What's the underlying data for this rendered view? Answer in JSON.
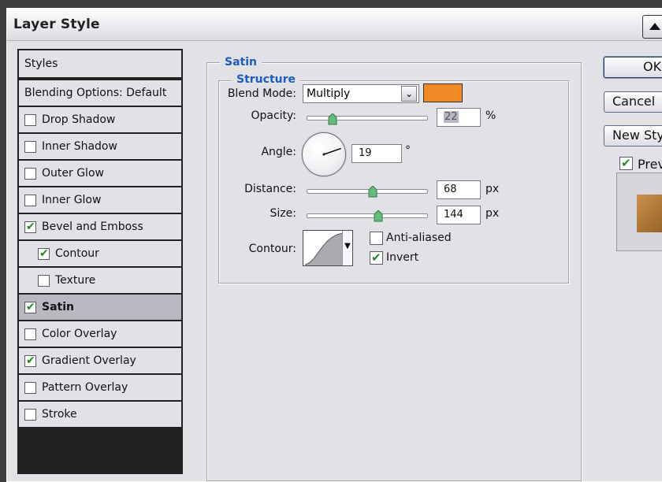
{
  "window": {
    "title": "Layer Style"
  },
  "styles_list": {
    "items": [
      {
        "label": "Styles",
        "has_checkbox": false,
        "checked": false,
        "selected": false,
        "indent": false
      },
      {
        "label": "Blending Options: Default",
        "has_checkbox": false,
        "checked": false,
        "selected": false,
        "indent": false
      },
      {
        "label": "Drop Shadow",
        "has_checkbox": true,
        "checked": false,
        "selected": false,
        "indent": false
      },
      {
        "label": "Inner Shadow",
        "has_checkbox": true,
        "checked": false,
        "selected": false,
        "indent": false
      },
      {
        "label": "Outer Glow",
        "has_checkbox": true,
        "checked": false,
        "selected": false,
        "indent": false
      },
      {
        "label": "Inner Glow",
        "has_checkbox": true,
        "checked": false,
        "selected": false,
        "indent": false
      },
      {
        "label": "Bevel and Emboss",
        "has_checkbox": true,
        "checked": true,
        "selected": false,
        "indent": false
      },
      {
        "label": "Contour",
        "has_checkbox": true,
        "checked": true,
        "selected": false,
        "indent": true
      },
      {
        "label": "Texture",
        "has_checkbox": true,
        "checked": false,
        "selected": false,
        "indent": true
      },
      {
        "label": "Satin",
        "has_checkbox": true,
        "checked": true,
        "selected": true,
        "indent": false
      },
      {
        "label": "Color Overlay",
        "has_checkbox": true,
        "checked": false,
        "selected": false,
        "indent": false
      },
      {
        "label": "Gradient Overlay",
        "has_checkbox": true,
        "checked": true,
        "selected": false,
        "indent": false
      },
      {
        "label": "Pattern Overlay",
        "has_checkbox": true,
        "checked": false,
        "selected": false,
        "indent": false
      },
      {
        "label": "Stroke",
        "has_checkbox": true,
        "checked": false,
        "selected": false,
        "indent": false
      }
    ]
  },
  "satin": {
    "title": "Satin",
    "structure": {
      "title": "Structure",
      "blend_mode": {
        "label": "Blend Mode:",
        "value": "Multiply",
        "color": "#f08a24"
      },
      "opacity": {
        "label": "Opacity:",
        "value": "22",
        "unit": "%",
        "slider_fraction": 0.22
      },
      "angle": {
        "label": "Angle:",
        "value": "19",
        "unit": "°",
        "degrees": 19
      },
      "distance": {
        "label": "Distance:",
        "value": "68",
        "unit": "px",
        "slider_fraction": 0.55
      },
      "size": {
        "label": "Size:",
        "value": "144",
        "unit": "px",
        "slider_fraction": 0.6
      },
      "contour": {
        "label": "Contour:"
      },
      "anti_aliased": {
        "label": "Anti-aliased",
        "checked": false
      },
      "invert": {
        "label": "Invert",
        "checked": true
      }
    }
  },
  "buttons": {
    "ok": "OK",
    "cancel": "Cancel",
    "new_style": "New Style...",
    "preview": {
      "label": "Preview",
      "checked": true
    }
  },
  "colors": {
    "accent_title": "#1e5cc0",
    "check": "#1e8a1e",
    "selected_row": "#b9b8c0"
  }
}
